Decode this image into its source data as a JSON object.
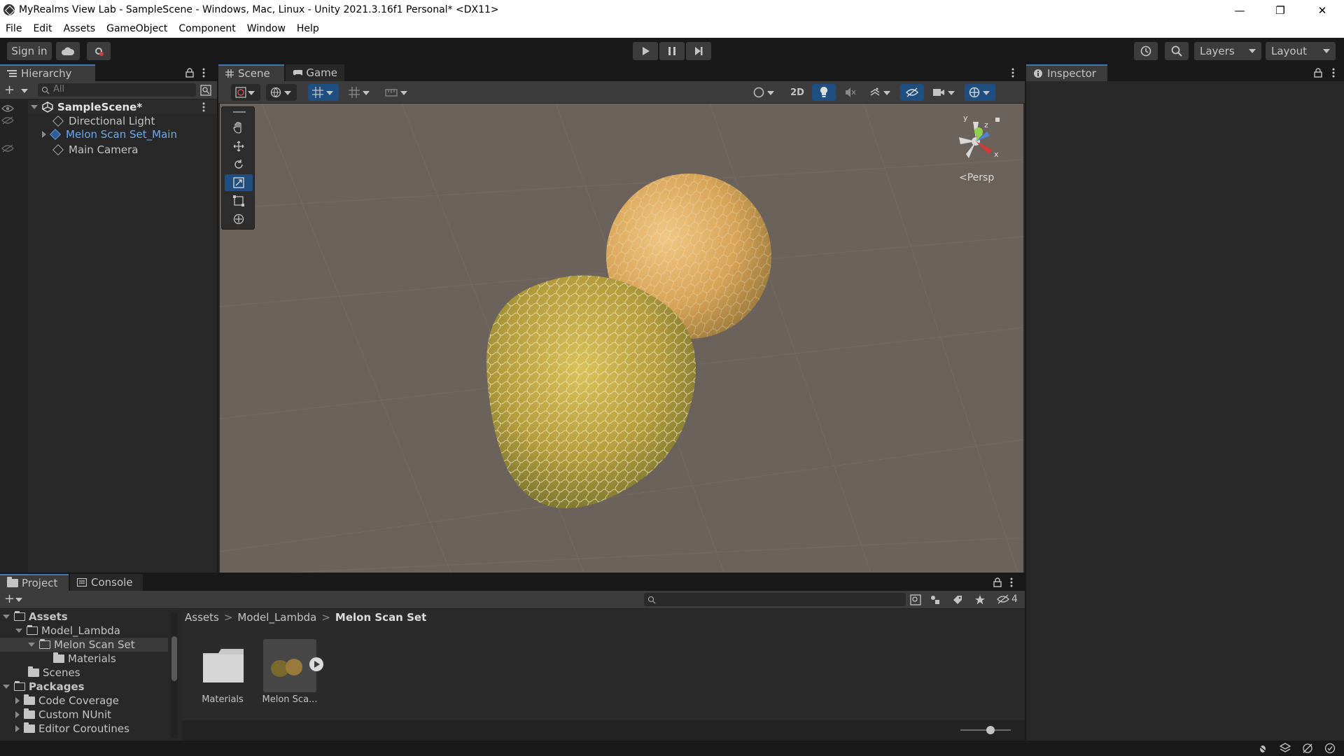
{
  "window": {
    "title": "MyRealms View Lab - SampleScene - Windows, Mac, Linux - Unity 2021.3.16f1 Personal* <DX11>",
    "minimize": "—",
    "maximize": "❐",
    "close": "✕"
  },
  "menu": [
    "File",
    "Edit",
    "Assets",
    "GameObject",
    "Component",
    "Window",
    "Help"
  ],
  "toolbar": {
    "sign_in": "Sign in",
    "layers": "Layers",
    "layout": "Layout"
  },
  "hierarchy": {
    "tab": "Hierarchy",
    "search_placeholder": "All",
    "scene": "SampleScene*",
    "items": [
      "Directional Light",
      "Melon Scan Set_Main",
      "Main Camera"
    ]
  },
  "scene": {
    "tabs": [
      "Scene",
      "Game"
    ],
    "mode_2d": "2D",
    "gizmo": {
      "y": "y",
      "z": "z",
      "x": "x",
      "projection": "Persp"
    }
  },
  "inspector": {
    "tab": "Inspector"
  },
  "project": {
    "tabs": [
      "Project",
      "Console"
    ],
    "hidden_count": "4",
    "breadcrumb": [
      "Assets",
      "Model_Lambda",
      "Melon Scan Set"
    ],
    "tree": {
      "assets": "Assets",
      "model_lambda": "Model_Lambda",
      "melon_scan_set": "Melon Scan Set",
      "materials": "Materials",
      "scenes": "Scenes",
      "packages": "Packages",
      "code_coverage": "Code Coverage",
      "custom_nunit": "Custom NUnit",
      "editor_coroutines": "Editor Coroutines"
    },
    "grid_items": [
      "Materials",
      "Melon Sca..."
    ],
    "zoom_level": 0.6
  },
  "colors": {
    "accent": "#3a79bb",
    "selected_text": "#6fa9e8",
    "scene_bg": "#6a625b"
  }
}
